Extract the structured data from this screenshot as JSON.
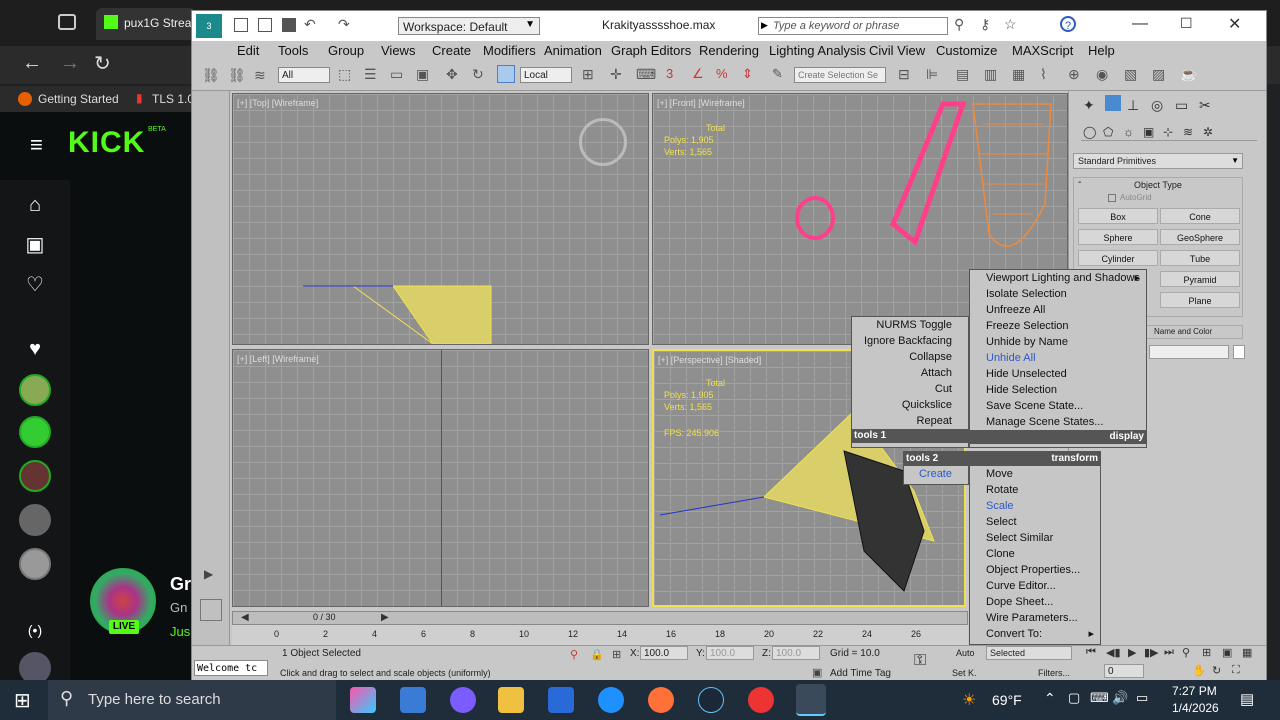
{
  "browser": {
    "tab_title": "pux1G Strea",
    "bookmarks": [
      "Getting Started",
      "TLS 1.0"
    ],
    "kick": {
      "logo": "KICK",
      "beta": "BETA",
      "live_badge": "LIVE",
      "stream_name": "Gr",
      "stream_sub": "Gn",
      "stream_sub2": "Jus"
    }
  },
  "max": {
    "title": "Krakityasssshoe.max",
    "workspace": "Workspace: Default",
    "search_placeholder": "Type a keyword or phrase",
    "menu": [
      "Edit",
      "Tools",
      "Group",
      "Views",
      "Create",
      "Modifiers",
      "Animation",
      "Graph Editors",
      "Rendering",
      "Lighting Analysis",
      "Civil View",
      "Customize",
      "MAXScript",
      "Help"
    ],
    "toolbar": {
      "filter": "All",
      "ref_coord": "Local",
      "create_selection_set": "Create Selection Se"
    },
    "viewports": {
      "top": "[+] [Top] [Wireframe]",
      "front": "[+] [Front] [Wireframe]",
      "left": "[+] [Left] [Wireframe]",
      "perspective": "[+] [Perspective] [Shaded]"
    },
    "stats_front": {
      "total": "Total",
      "polys": "Polys:  1,905",
      "verts": "Verts:  1,565"
    },
    "stats_persp": {
      "total": "Total",
      "polys": "Polys:  1,905",
      "verts": "Verts:  1,565",
      "fps": "FPS:   245.906"
    },
    "command_panel": {
      "category": "Standard Primitives",
      "rollout_title": "Object Type",
      "autogrid": "AutoGrid",
      "buttons": [
        "Box",
        "Cone",
        "Sphere",
        "GeoSphere",
        "Cylinder",
        "Tube",
        "",
        "Pyramid",
        "",
        "Plane"
      ],
      "name_color": "Name and Color"
    },
    "quad": {
      "tools1_items": [
        "NURMS Toggle",
        "Ignore Backfacing",
        "Collapse",
        "Attach",
        "Cut",
        "Quickslice",
        "Repeat"
      ],
      "tools1_label": "tools 1",
      "tools2_label": "tools 2",
      "tools2_items": [
        "Create"
      ],
      "display_items": [
        "Viewport Lighting and Shadows",
        "Isolate Selection",
        "Unfreeze All",
        "Freeze Selection",
        "Unhide by Name",
        "Unhide All",
        "Hide Unselected",
        "Hide Selection",
        "Save Scene State...",
        "Manage Scene States..."
      ],
      "display_label": "display",
      "transform_label": "transform",
      "transform_items": [
        "Move",
        "Rotate",
        "Scale",
        "Select",
        "Select Similar",
        "Clone",
        "Object Properties...",
        "Curve Editor...",
        "Dope Sheet...",
        "Wire Parameters...",
        "Convert To:"
      ]
    },
    "timeline": {
      "frame": "0 / 30",
      "ticks": [
        "0",
        "2",
        "4",
        "6",
        "8",
        "10",
        "12",
        "14",
        "16",
        "18",
        "20",
        "22",
        "24",
        "26"
      ]
    },
    "status": {
      "script_listener": "Welcome tc",
      "selected": "1 Object Selected",
      "prompt": "Click and drag to select and scale objects (uniformly)",
      "x": "100.0",
      "y": "100.0",
      "z": "100.0",
      "grid": "Grid = 10.0",
      "add_time_tag": "Add Time Tag",
      "auto": "Auto",
      "set_key": "Set K.",
      "selected_dd": "Selected",
      "filters": "Filters...",
      "frame_field": "0"
    }
  },
  "taskbar": {
    "search_placeholder": "Type here to search",
    "weather": "69°F",
    "time": "7:27 PM",
    "date": "1/4/2026"
  }
}
